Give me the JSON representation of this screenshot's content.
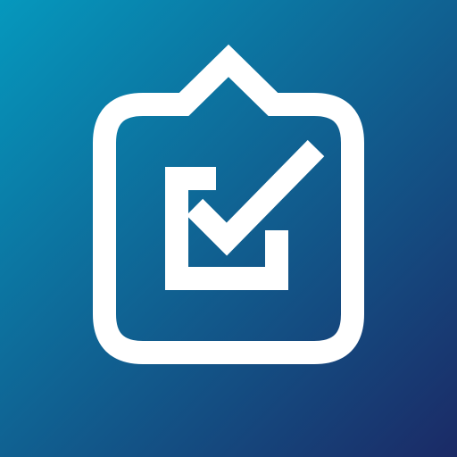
{
  "app_icon": {
    "icon": "clipboard-check-icon",
    "colors": {
      "gradient_start": "#0598BD",
      "gradient_end": "#1B2A66",
      "glyph": "#FFFFFF"
    }
  }
}
